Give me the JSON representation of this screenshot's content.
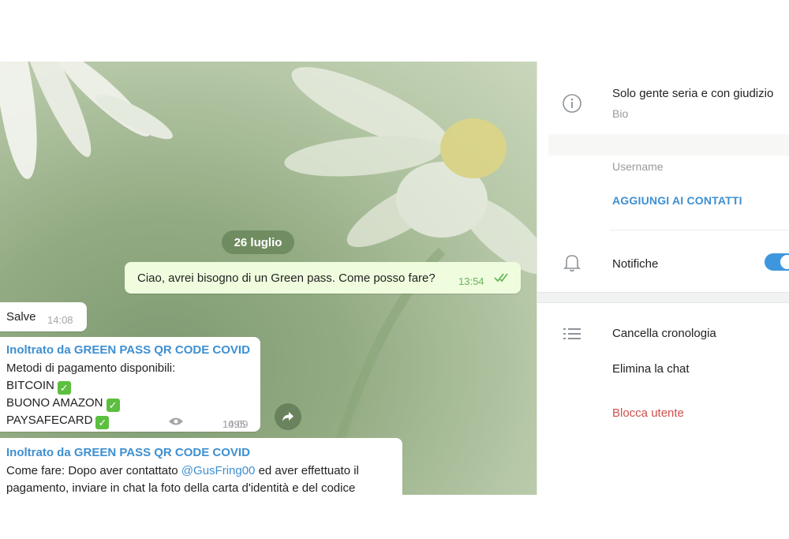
{
  "chat": {
    "date_chip": "26 luglio",
    "messages": [
      {
        "text": "Ciao, avrei bisogno di un Green pass. Come posso fare?",
        "time": "13:54"
      },
      {
        "text": "Salve",
        "time": "14:08"
      },
      {
        "forwarded_from": "Inoltrato da GREEN PASS QR CODE COVID",
        "lines": [
          "Metodi di pagamento disponibili:",
          "BITCOIN",
          "BUONO AMAZON",
          "PAYSAFECARD"
        ],
        "views": "1095",
        "time": "14:09"
      },
      {
        "forwarded_from": "Inoltrato da GREEN PASS QR CODE COVID",
        "line1_pre": "Come fare: Dopo aver contattato ",
        "line1_mention": "@GusFring00",
        "line1_post": " ed aver effettuato il",
        "line2": "pagamento, inviare in chat la foto della carta d'identità e del codice"
      }
    ]
  },
  "panel": {
    "bio": {
      "value": "Solo gente seria e con giudizio",
      "label": "Bio"
    },
    "username_label": "Username",
    "add_contact": "AGGIUNGI AI CONTATTI",
    "notifications": {
      "label": "Notifiche",
      "enabled": true
    },
    "actions": {
      "clear_history": "Cancella cronologia",
      "delete_chat": "Elimina la chat",
      "block_user": "Blocca utente"
    }
  },
  "colors": {
    "accent": "#3e8fd1",
    "danger": "#d14f4f",
    "out_bubble": "#effdde"
  }
}
